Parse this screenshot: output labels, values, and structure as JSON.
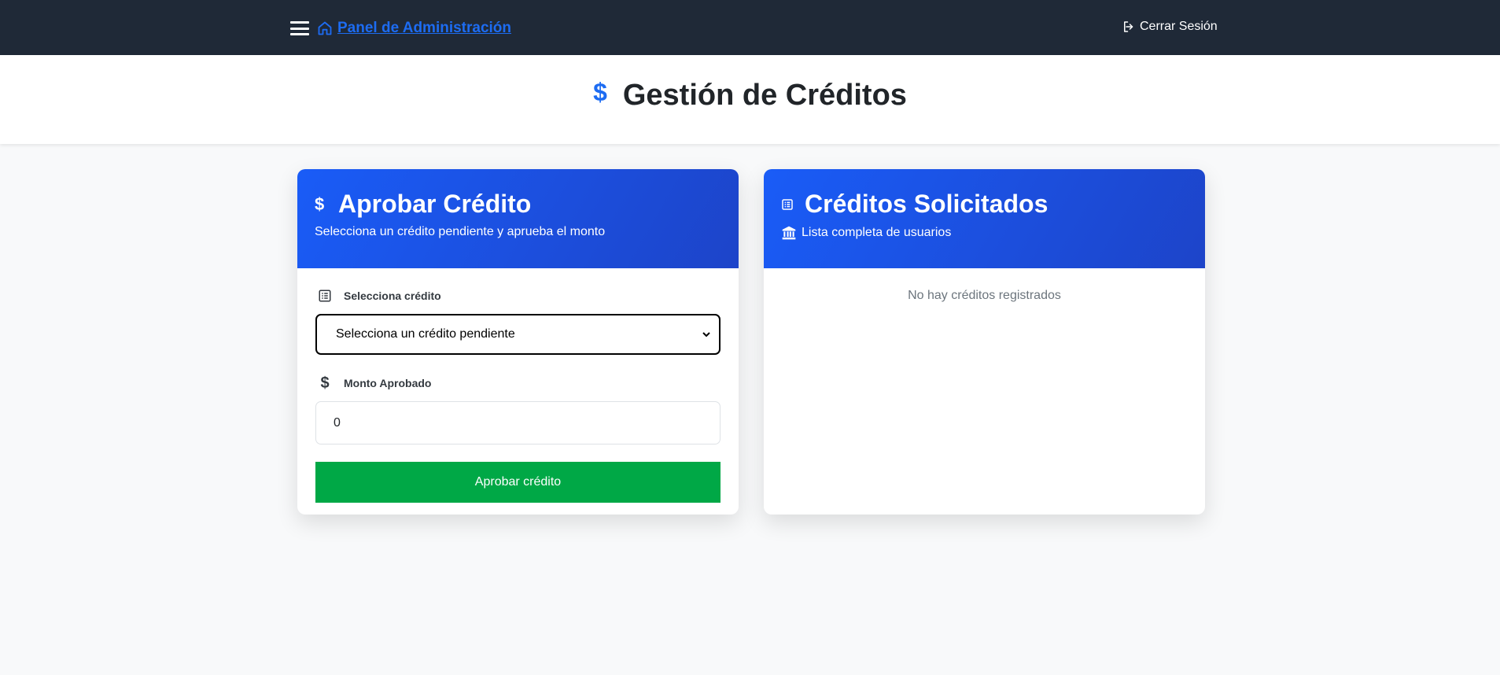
{
  "navbar": {
    "menu_icon": "hamburger-menu-icon",
    "home_icon": "home-icon",
    "brand_label": "Panel de Administración",
    "logout_icon": "logout-icon",
    "logout_label": "Cerrar Sesión",
    "brand_color": "#1d6cf2",
    "bg_color": "#1f2937"
  },
  "page": {
    "title_icon": "dollar-icon",
    "title": "Gestión de Créditos"
  },
  "approve_card": {
    "title_icon": "dollar-icon",
    "title": "Aprobar Crédito",
    "subtitle": "Selecciona un crédito pendiente y aprueba el monto",
    "select_label": "Selecciona crédito",
    "select_icon": "list-icon",
    "select_value": "Selecciona un crédito pendiente",
    "amount_label": "Monto Aprobado",
    "amount_icon": "dollar-icon",
    "amount_value": "0",
    "button_label": "Aprobar crédito",
    "button_color": "#00a846"
  },
  "requests_card": {
    "title_icon": "list-icon",
    "title": "Créditos Solicitados",
    "subtitle_icon": "bank-icon",
    "subtitle": "Lista completa de usuarios",
    "empty_message": "No hay créditos registrados"
  }
}
